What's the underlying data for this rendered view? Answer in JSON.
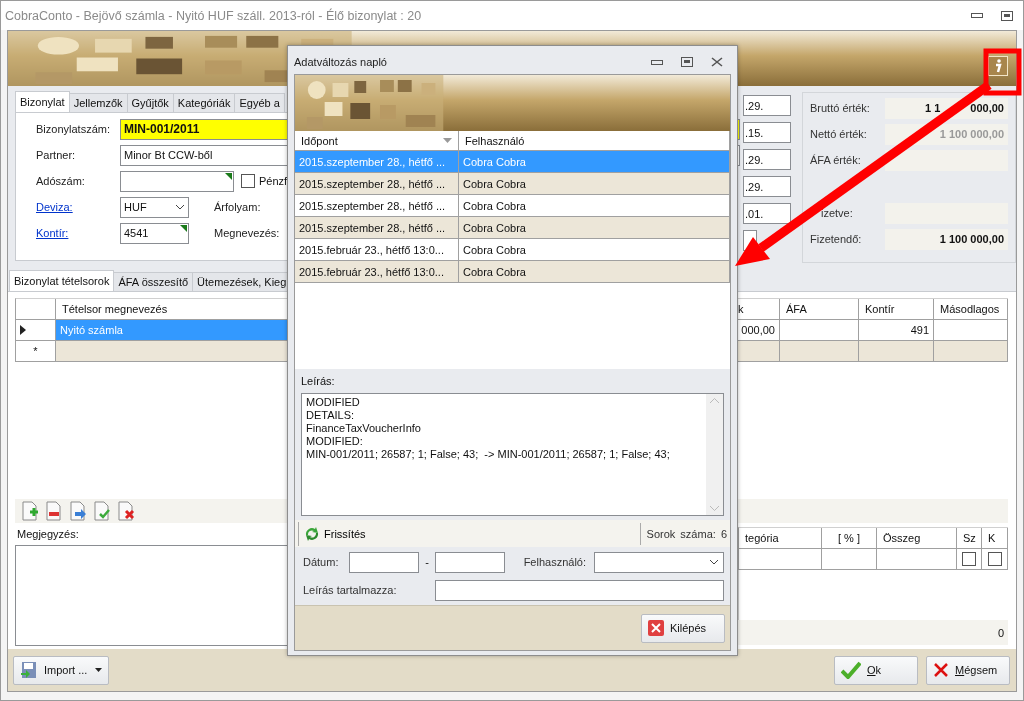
{
  "window": {
    "title": "CobraConto - Bejövő számla -  Nyitó HUF száll. 2013-ról - Élő bizonylat : 20"
  },
  "header_tabs": [
    {
      "label": "Bizonylat",
      "selected": true
    },
    {
      "label": "Jellemzők",
      "selected": false
    },
    {
      "label": "Gyűjtők",
      "selected": false
    },
    {
      "label": "Kategóriák",
      "selected": false
    },
    {
      "label": "Egyéb a",
      "selected": false
    }
  ],
  "form": {
    "voucher_number": {
      "label": "Bizonylatszám:",
      "value": "MIN-001/2011"
    },
    "partner": {
      "label": "Partner:",
      "value": "Minor Bt CCW-ből"
    },
    "tax_number": {
      "label": "Adószám:"
    },
    "cash_checkbox": {
      "label": "Pénzf",
      "checked": false
    },
    "currency": {
      "label": "Deviza:",
      "value": "HUF"
    },
    "exchange_rate": {
      "label": "Árfolyam:"
    },
    "account": {
      "label": "Kontír:",
      "value": "4541"
    },
    "name": {
      "label": "Megnevezés:"
    }
  },
  "dates": [
    ".29.",
    ".15.",
    ".29.",
    ".29.",
    ".01."
  ],
  "summary": {
    "totals": [
      {
        "label": "Bruttó érték:",
        "value_parts": [
          "1 1",
          "000,00"
        ],
        "muted": false
      },
      {
        "label": "Nettó érték:",
        "value": "1 100 000,00",
        "muted": true
      },
      {
        "label": "ÁFA érték:"
      }
    ],
    "payment": [
      {
        "label": "izetve:"
      },
      {
        "label": "Fizetendő:",
        "value": "1 100 000,00",
        "muted": false
      }
    ]
  },
  "item_tabs": [
    {
      "label": "Bizonylat tételsorok",
      "selected": true
    },
    {
      "label": "ÁFA összesítő",
      "selected": false
    },
    {
      "label": "Ütemezések, Kieg",
      "selected": false
    }
  ],
  "items_table": {
    "columns": [
      "Tételsor megnevezés",
      "k",
      "ÁFA",
      "Kontír",
      "Másodlagos"
    ],
    "rows": [
      {
        "name": "Nyitó számla",
        "column_2": "000,00",
        "account": "491",
        "selected": true
      }
    ],
    "new_row_marker": "*"
  },
  "note": {
    "label": "Megjegyzés:"
  },
  "category_table": {
    "columns": [
      "tegória",
      "[ % ]",
      "Összeg",
      "Sz",
      "K"
    ],
    "rows": [
      {
        "sz_checked": false,
        "k_checked": false
      }
    ],
    "total": "0"
  },
  "buttons": {
    "import": "Import ...",
    "ok": "Ok",
    "cancel": "Mégsem"
  },
  "dialog": {
    "title": "Adatváltozás napló",
    "columns": [
      "Időpont",
      "Felhasználó"
    ],
    "rows": [
      {
        "time": "2015.szeptember 28., hétfő ...",
        "user": "Cobra Cobra",
        "selected": true
      },
      {
        "time": "2015.szeptember 28., hétfő ...",
        "user": "Cobra Cobra",
        "selected": false
      },
      {
        "time": "2015.szeptember 28., hétfő ...",
        "user": "Cobra Cobra",
        "selected": false
      },
      {
        "time": "2015.szeptember 28., hétfő ...",
        "user": "Cobra Cobra",
        "selected": false
      },
      {
        "time": "2015.február 23., hétfő 13:0...",
        "user": "Cobra Cobra",
        "selected": false
      },
      {
        "time": "2015.február 23., hétfő 13:0...",
        "user": "Cobra Cobra",
        "selected": false
      }
    ],
    "description_label": "Leírás:",
    "description": [
      "MODIFIED",
      "DETAILS:",
      "FinanceTaxVoucherInfo",
      "MODIFIED:",
      "MIN-001/2011; 26587; 1; False; 43;  -> MIN-001/2011; 26587; 1; False; 43;"
    ],
    "refresh": "Frissítés",
    "row_count_label": "Sorok száma:",
    "row_count": "6",
    "filters": {
      "date_label": "Dátum:",
      "date_separator": "-",
      "user_label": "Felhasználó:",
      "text_label": "Leírás tartalmazza:"
    },
    "exit": "Kilépés"
  }
}
